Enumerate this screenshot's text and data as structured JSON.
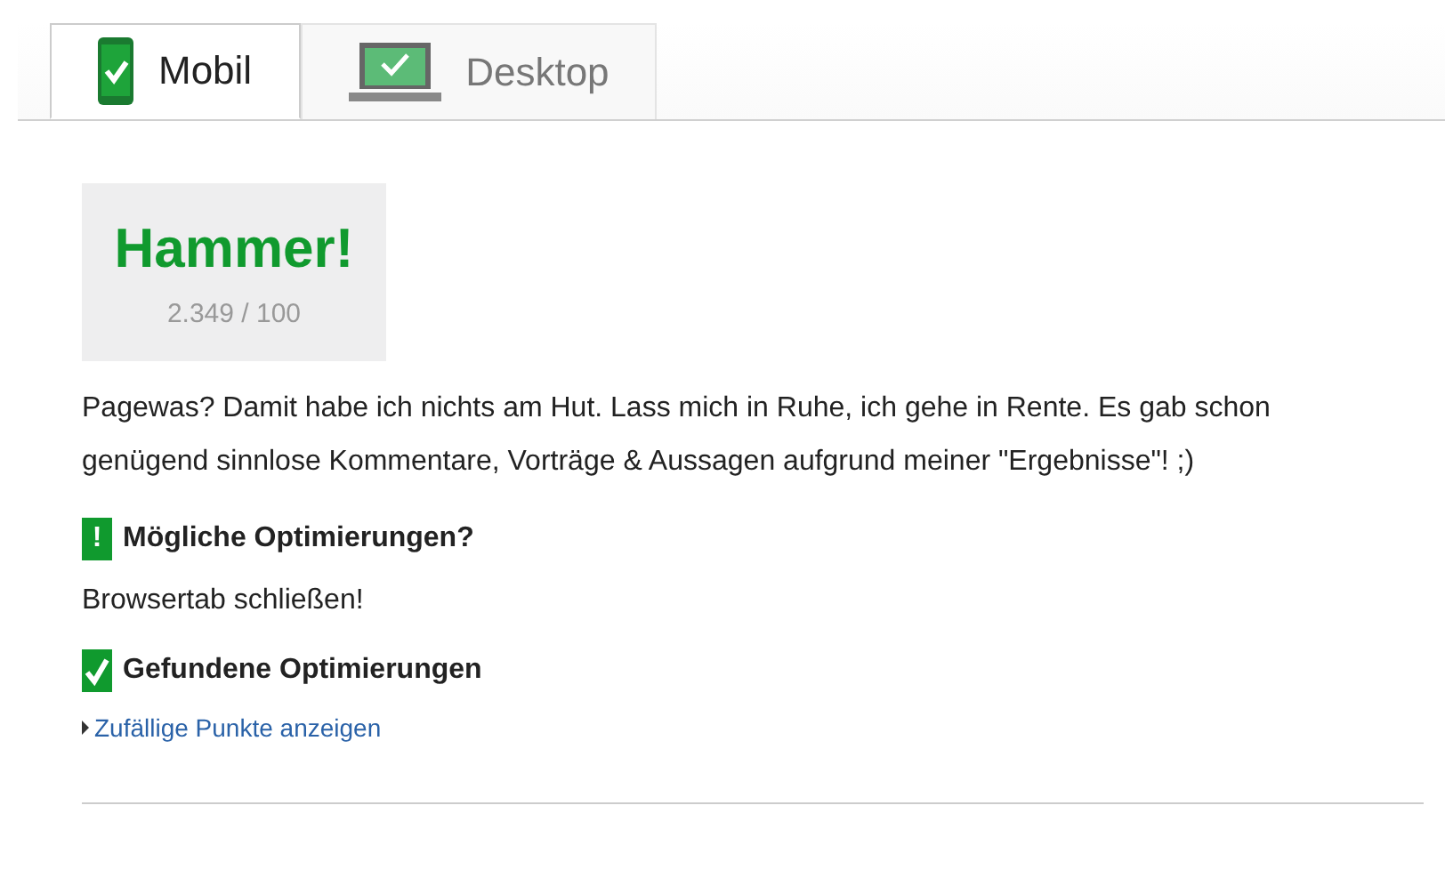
{
  "tabs": [
    {
      "label": "Mobil",
      "kind": "mobile",
      "selected": true
    },
    {
      "label": "Desktop",
      "kind": "desktop",
      "selected": false
    }
  ],
  "score": {
    "title": "Hammer!",
    "value": "2.349 / 100"
  },
  "summary": "Pagewas? Damit habe ich nichts am Hut. Lass mich in Ruhe, ich gehe in Rente. Es gab schon genügend sinnlose Kommentare, Vorträge & Aussagen aufgrund meiner \"Ergebnisse\"! ;)",
  "sections": [
    {
      "kind": "warning",
      "mark": "!",
      "title": "Mögliche Optimierungen?",
      "body": "Browsertab schließen!"
    },
    {
      "kind": "passed",
      "title": "Gefundene Optimierungen",
      "link": "Zufällige Punkte anzeigen"
    }
  ]
}
